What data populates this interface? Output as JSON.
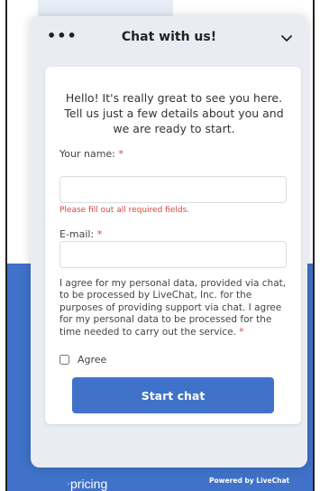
{
  "header": {
    "menu_icon": "more-dots-icon",
    "title": "Chat with us!",
    "minimize_icon": "chevron-down-icon"
  },
  "form": {
    "welcome": "Hello! It's really great to see you here. Tell us just a few details about you and we are ready to start.",
    "name_label": "Your name:",
    "required_marker": "*",
    "name_value": "",
    "error": "Please fill out all required fields.",
    "email_label": "E-mail:",
    "email_value": "",
    "consent": "I agree for my personal data, provided via chat, to be processed by LiveChat, Inc. for the purposes of providing support via chat. I agree for my personal data to be processed for the time needed to carry out the service.",
    "agree_label": "Agree",
    "submit_label": "Start chat"
  },
  "footer": {
    "powered_by": "Powered by LiveChat"
  },
  "background": {
    "link_label": "pricing"
  },
  "colors": {
    "accent": "#3f72c8",
    "error": "#d4483d",
    "widget_bg": "#e9edf3"
  }
}
